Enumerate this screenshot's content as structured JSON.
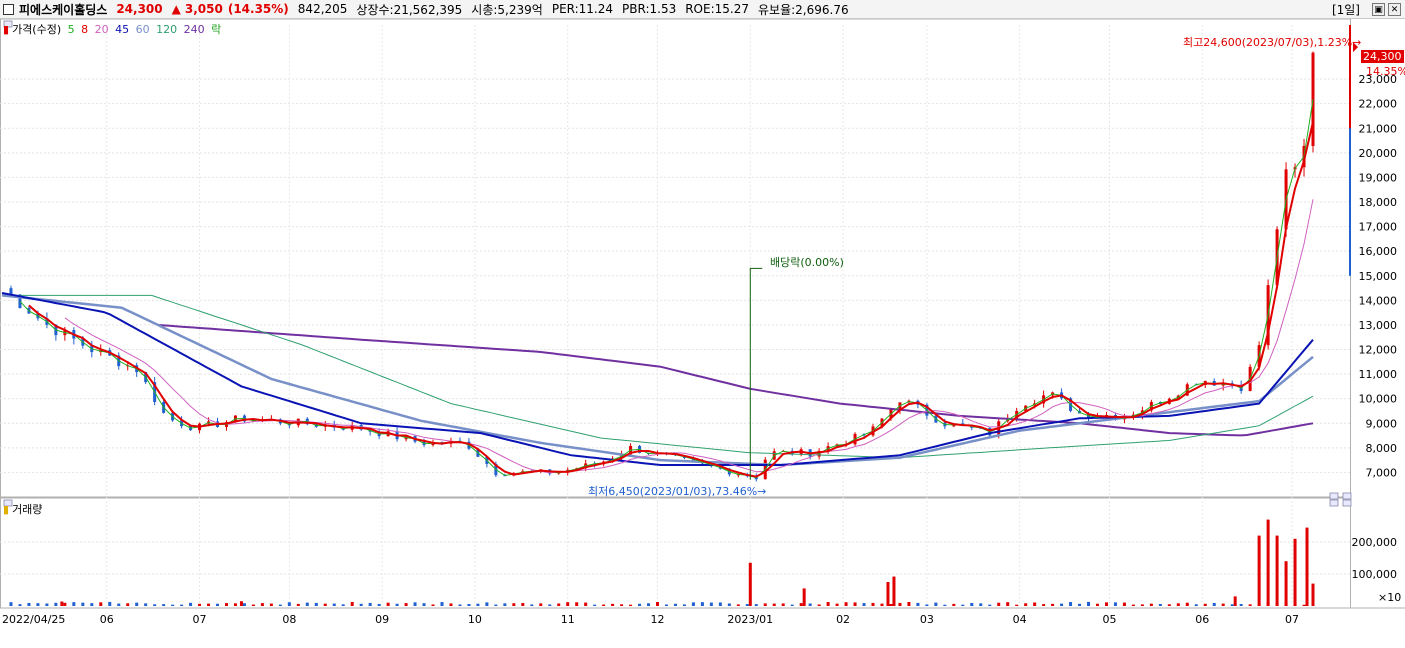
{
  "header": {
    "name": "피에스케이홀딩스",
    "price": "24,300",
    "arrow": "▲",
    "change": "3,050",
    "change_pct": "(14.35%)",
    "volume": "842,205",
    "listed": "상장수:21,562,395",
    "mktcap": "시총:5,239억",
    "per": "PER:11.24",
    "pbr": "PBR:1.53",
    "roe": "ROE:15.27",
    "reserve": "유보율:2,696.76",
    "period": "[1일]"
  },
  "price_legend": {
    "label": "가격(수정)",
    "ma": [
      "5",
      "8",
      "20",
      "45",
      "60",
      "120",
      "240"
    ],
    "ex": "락"
  },
  "volume_legend": {
    "label": "거래량"
  },
  "annotations": {
    "high": "최고24,600(2023/07/03),1.23%→",
    "low": "최저6,450(2023/01/03),73.46%→",
    "dividend": "배당락(0.00%)",
    "last_price": "24,300",
    "last_pct": "14.35%",
    "vol_scale": "×10"
  },
  "colors": {
    "up": "#e00000",
    "down": "#2060d0",
    "ma5": "#20b020",
    "ma8": "#e00000",
    "ma20": "#d060c0",
    "ma45": "#0a14b4",
    "ma60": "#7890c8",
    "ma120": "#30a070",
    "ma240": "#7030a0"
  },
  "chart_data": {
    "type": "candlestick",
    "title": "피에스케이홀딩스",
    "y_ticks": [
      7000,
      8000,
      9000,
      10000,
      11000,
      12000,
      13000,
      14000,
      15000,
      16000,
      17000,
      18000,
      19000,
      20000,
      21000,
      22000,
      23000
    ],
    "ylim": [
      6000,
      25200
    ],
    "x_labels": [
      "2022/04/25",
      "06",
      "07",
      "08",
      "09",
      "10",
      "11",
      "12",
      "2023/01",
      "02",
      "03",
      "04",
      "05",
      "06",
      "07"
    ],
    "x_label_days": [
      0,
      35,
      66,
      96,
      127,
      158,
      189,
      219,
      250,
      281,
      309,
      340,
      370,
      401,
      431
    ],
    "close_keypoints": [
      [
        0,
        14500
      ],
      [
        15,
        13000
      ],
      [
        30,
        12000
      ],
      [
        45,
        11200
      ],
      [
        55,
        9200
      ],
      [
        65,
        8800
      ],
      [
        80,
        9200
      ],
      [
        100,
        9000
      ],
      [
        120,
        8800
      ],
      [
        140,
        8200
      ],
      [
        155,
        8200
      ],
      [
        165,
        7000
      ],
      [
        185,
        7000
      ],
      [
        200,
        7400
      ],
      [
        210,
        8000
      ],
      [
        230,
        7400
      ],
      [
        245,
        7000
      ],
      [
        252,
        6800
      ],
      [
        256,
        7800
      ],
      [
        270,
        7800
      ],
      [
        290,
        8600
      ],
      [
        300,
        10000
      ],
      [
        315,
        9000
      ],
      [
        330,
        8600
      ],
      [
        340,
        9800
      ],
      [
        350,
        10200
      ],
      [
        360,
        9400
      ],
      [
        375,
        9300
      ],
      [
        385,
        9800
      ],
      [
        400,
        10800
      ],
      [
        415,
        10500
      ],
      [
        420,
        12200
      ],
      [
        425,
        16000
      ],
      [
        427,
        18000
      ],
      [
        431,
        20000
      ],
      [
        433,
        18500
      ],
      [
        436,
        21000
      ],
      [
        438,
        24300
      ]
    ],
    "ma_keypoints": {
      "ma240": [
        [
          52,
          13000
        ],
        [
          120,
          12400
        ],
        [
          180,
          11900
        ],
        [
          220,
          11300
        ],
        [
          250,
          10400
        ],
        [
          280,
          9800
        ],
        [
          320,
          9300
        ],
        [
          360,
          9000
        ],
        [
          390,
          8600
        ],
        [
          415,
          8500
        ],
        [
          438,
          9000
        ]
      ],
      "ma120": [
        [
          0,
          14200
        ],
        [
          50,
          14200
        ],
        [
          100,
          12200
        ],
        [
          150,
          9800
        ],
        [
          200,
          8400
        ],
        [
          250,
          7800
        ],
        [
          300,
          7600
        ],
        [
          350,
          8000
        ],
        [
          390,
          8300
        ],
        [
          420,
          8900
        ],
        [
          438,
          10100
        ]
      ],
      "ma60": [
        [
          0,
          14200
        ],
        [
          40,
          13700
        ],
        [
          90,
          10800
        ],
        [
          140,
          9100
        ],
        [
          180,
          8200
        ],
        [
          220,
          7500
        ],
        [
          260,
          7300
        ],
        [
          300,
          7600
        ],
        [
          340,
          8700
        ],
        [
          380,
          9300
        ],
        [
          420,
          9900
        ],
        [
          438,
          11700
        ]
      ],
      "ma45": [
        [
          0,
          14300
        ],
        [
          35,
          13500
        ],
        [
          80,
          10500
        ],
        [
          120,
          9000
        ],
        [
          160,
          8600
        ],
        [
          190,
          7700
        ],
        [
          220,
          7300
        ],
        [
          260,
          7300
        ],
        [
          300,
          7700
        ],
        [
          330,
          8600
        ],
        [
          360,
          9200
        ],
        [
          390,
          9300
        ],
        [
          420,
          9800
        ],
        [
          438,
          12400
        ]
      ]
    },
    "volume": {
      "ylim": [
        0,
        30000
      ],
      "y_ticks": [
        10000,
        20000
      ],
      "y_tick_labels": [
        "100,000",
        "200,000"
      ],
      "spikes": [
        [
          20,
          1400
        ],
        [
          80,
          1500
        ],
        [
          250,
          13500
        ],
        [
          268,
          5500
        ],
        [
          298,
          9200
        ],
        [
          296,
          7500
        ],
        [
          412,
          3000
        ],
        [
          420,
          22000
        ],
        [
          423,
          27000
        ],
        [
          426,
          22000
        ],
        [
          429,
          14000
        ],
        [
          432,
          21000
        ],
        [
          436,
          24500
        ],
        [
          438,
          7000
        ]
      ]
    }
  }
}
